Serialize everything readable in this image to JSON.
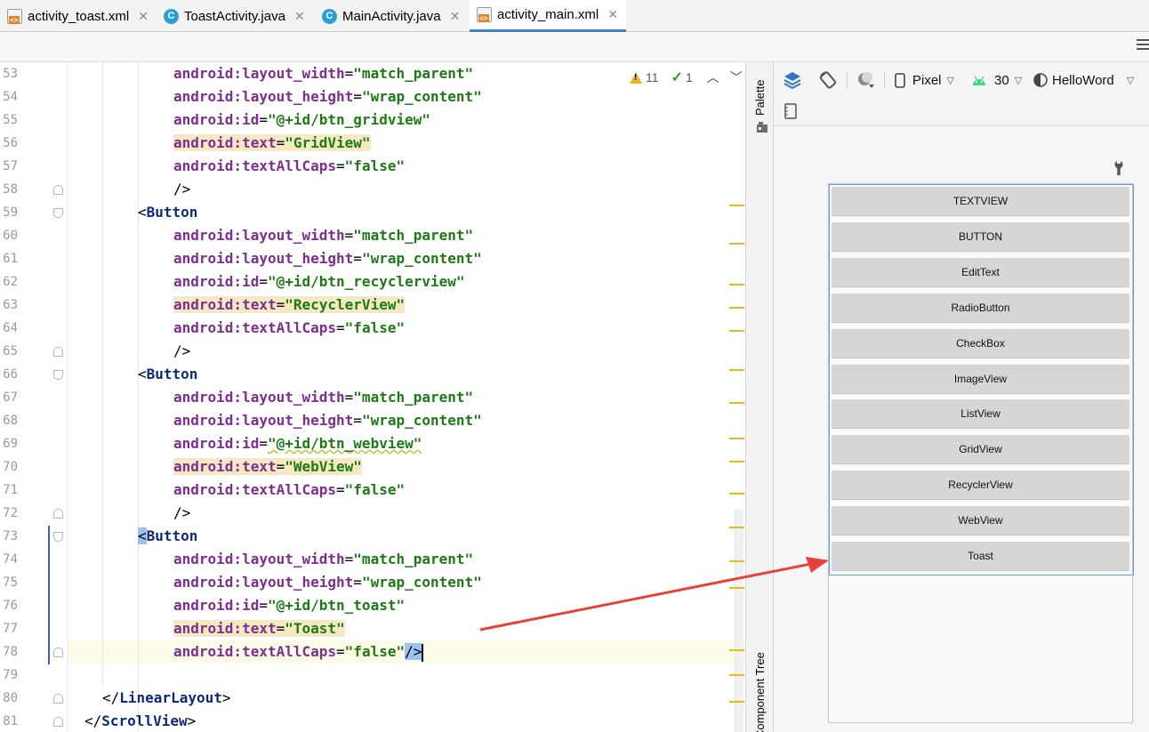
{
  "tabs": [
    {
      "label": "activity_toast.xml",
      "icon": "xml-file-icon",
      "active": false
    },
    {
      "label": "ToastActivity.java",
      "icon": "java-class-icon",
      "active": false
    },
    {
      "label": "MainActivity.java",
      "icon": "java-class-icon",
      "active": false
    },
    {
      "label": "activity_main.xml",
      "icon": "xml-file-icon",
      "active": true
    }
  ],
  "editor": {
    "inspection": {
      "warnings": "11",
      "weak_warnings": "1"
    },
    "lines": [
      {
        "num": "53",
        "tokens": [
          {
            "t": "attr",
            "v": "android:layout_width"
          },
          {
            "t": "punc",
            "v": "="
          },
          {
            "t": "str",
            "v": "\"match_parent\""
          }
        ]
      },
      {
        "num": "54",
        "tokens": [
          {
            "t": "attr",
            "v": "android:layout_height"
          },
          {
            "t": "punc",
            "v": "="
          },
          {
            "t": "str",
            "v": "\"wrap_content\""
          }
        ]
      },
      {
        "num": "55",
        "tokens": [
          {
            "t": "attr",
            "v": "android:id"
          },
          {
            "t": "punc",
            "v": "="
          },
          {
            "t": "str",
            "v": "\"@+id/btn_gridview\""
          }
        ]
      },
      {
        "num": "56",
        "tokens": [
          {
            "t": "attr",
            "v": "android:text",
            "hl": true
          },
          {
            "t": "punc",
            "v": "=",
            "hl": true
          },
          {
            "t": "str",
            "v": "\"GridView\"",
            "hl": true
          }
        ]
      },
      {
        "num": "57",
        "tokens": [
          {
            "t": "attr",
            "v": "android:textAllCaps"
          },
          {
            "t": "punc",
            "v": "="
          },
          {
            "t": "str",
            "v": "\"false\""
          }
        ]
      },
      {
        "num": "58",
        "tokens": [
          {
            "t": "punc",
            "v": "/>"
          }
        ]
      },
      {
        "num": "59",
        "tokens": [
          {
            "t": "punc",
            "v": "<"
          },
          {
            "t": "tag",
            "v": "Button"
          }
        ]
      },
      {
        "num": "60",
        "tokens": [
          {
            "t": "attr",
            "v": "android:layout_width"
          },
          {
            "t": "punc",
            "v": "="
          },
          {
            "t": "str",
            "v": "\"match_parent\""
          }
        ]
      },
      {
        "num": "61",
        "tokens": [
          {
            "t": "attr",
            "v": "android:layout_height"
          },
          {
            "t": "punc",
            "v": "="
          },
          {
            "t": "str",
            "v": "\"wrap_content\""
          }
        ]
      },
      {
        "num": "62",
        "tokens": [
          {
            "t": "attr",
            "v": "android:id"
          },
          {
            "t": "punc",
            "v": "="
          },
          {
            "t": "str",
            "v": "\"@+id/btn_recyclerview\""
          }
        ]
      },
      {
        "num": "63",
        "tokens": [
          {
            "t": "attr",
            "v": "android:text",
            "hl": true
          },
          {
            "t": "punc",
            "v": "=",
            "hl": true
          },
          {
            "t": "str",
            "v": "\"RecyclerView\"",
            "hl": true
          }
        ]
      },
      {
        "num": "64",
        "tokens": [
          {
            "t": "attr",
            "v": "android:textAllCaps"
          },
          {
            "t": "punc",
            "v": "="
          },
          {
            "t": "str",
            "v": "\"false\""
          }
        ]
      },
      {
        "num": "65",
        "tokens": [
          {
            "t": "punc",
            "v": "/>"
          }
        ]
      },
      {
        "num": "66",
        "tokens": [
          {
            "t": "punc",
            "v": "<"
          },
          {
            "t": "tag",
            "v": "Button"
          }
        ]
      },
      {
        "num": "67",
        "tokens": [
          {
            "t": "attr",
            "v": "android:layout_width"
          },
          {
            "t": "punc",
            "v": "="
          },
          {
            "t": "str",
            "v": "\"match_parent\""
          }
        ]
      },
      {
        "num": "68",
        "tokens": [
          {
            "t": "attr",
            "v": "android:layout_height"
          },
          {
            "t": "punc",
            "v": "="
          },
          {
            "t": "str",
            "v": "\"wrap_content\""
          }
        ]
      },
      {
        "num": "69",
        "tokens": [
          {
            "t": "attr",
            "v": "android:id"
          },
          {
            "t": "punc",
            "v": "="
          },
          {
            "t": "str",
            "v": "\"@+id/btn_webview\""
          }
        ]
      },
      {
        "num": "70",
        "tokens": [
          {
            "t": "attr",
            "v": "android:text",
            "hl": true
          },
          {
            "t": "punc",
            "v": "=",
            "hl": true
          },
          {
            "t": "str",
            "v": "\"WebView\"",
            "hl": true
          }
        ]
      },
      {
        "num": "71",
        "tokens": [
          {
            "t": "attr",
            "v": "android:textAllCaps"
          },
          {
            "t": "punc",
            "v": "="
          },
          {
            "t": "str",
            "v": "\"false\""
          }
        ]
      },
      {
        "num": "72",
        "tokens": [
          {
            "t": "punc",
            "v": "/>"
          }
        ]
      },
      {
        "num": "73",
        "tokens": [
          {
            "t": "punc",
            "v": "<",
            "sel": true
          },
          {
            "t": "tag",
            "v": "Button"
          }
        ]
      },
      {
        "num": "74",
        "tokens": [
          {
            "t": "attr",
            "v": "android:layout_width"
          },
          {
            "t": "punc",
            "v": "="
          },
          {
            "t": "str",
            "v": "\"match_parent\""
          }
        ]
      },
      {
        "num": "75",
        "tokens": [
          {
            "t": "attr",
            "v": "android:layout_height"
          },
          {
            "t": "punc",
            "v": "="
          },
          {
            "t": "str",
            "v": "\"wrap_content\""
          }
        ]
      },
      {
        "num": "76",
        "tokens": [
          {
            "t": "attr",
            "v": "android:id"
          },
          {
            "t": "punc",
            "v": "="
          },
          {
            "t": "str",
            "v": "\"@+id/btn_toast\""
          }
        ]
      },
      {
        "num": "77",
        "tokens": [
          {
            "t": "attr",
            "v": "android:text",
            "hl": true
          },
          {
            "t": "punc",
            "v": "=",
            "hl": true
          },
          {
            "t": "str",
            "v": "\"Toast\"",
            "hl": true
          }
        ]
      },
      {
        "num": "78",
        "tokens": [
          {
            "t": "attr",
            "v": "android:textAllCaps"
          },
          {
            "t": "punc",
            "v": "="
          },
          {
            "t": "str",
            "v": "\"false\""
          },
          {
            "t": "punc",
            "v": "/>",
            "sel": true
          }
        ]
      },
      {
        "num": "79",
        "tokens": []
      },
      {
        "num": "80",
        "tokens": [
          {
            "t": "punc",
            "v": "</"
          },
          {
            "t": "tag",
            "v": "LinearLayout"
          },
          {
            "t": "punc",
            "v": ">"
          }
        ]
      },
      {
        "num": "81",
        "tokens": [
          {
            "t": "punc",
            "v": "</"
          },
          {
            "t": "tag",
            "v": "ScrollView"
          },
          {
            "t": "punc",
            "v": ">"
          }
        ]
      }
    ]
  },
  "side_strip": {
    "palette_label": "Palette",
    "component_tree_label": "Component Tree"
  },
  "design_toolbar": {
    "device": "Pixel",
    "api": "30",
    "theme": "HelloWord"
  },
  "preview_buttons": [
    "TEXTVIEW",
    "BUTTON",
    "EditText",
    "RadioButton",
    "CheckBox",
    "ImageView",
    "ListView",
    "GridView",
    "RecyclerView",
    "WebView",
    "Toast"
  ],
  "colors": {
    "accent": "#4083c9",
    "attribute": "#7d2e8f",
    "string": "#1d7a14",
    "tag": "#0d2a7a",
    "warning": "#e9b71f",
    "annotation_arrow": "#e8413a"
  }
}
